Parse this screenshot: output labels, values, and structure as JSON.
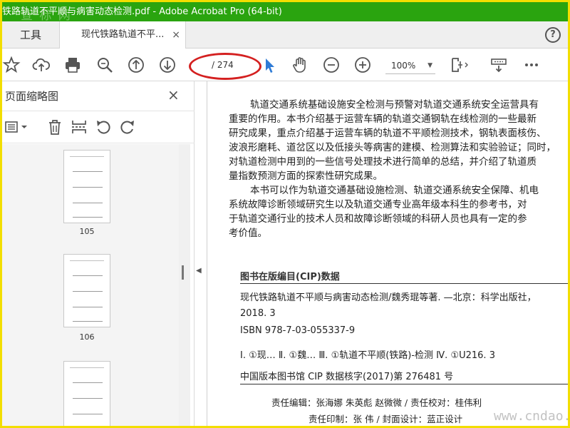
{
  "window": {
    "title": "铁路轨道不平顺与病害动态检测.pdf - Adobe Acrobat Pro (64-bit)",
    "watermark": "查 标 网"
  },
  "tabs": {
    "tools": "工具",
    "document": "现代铁路轨道不平...",
    "close": "×",
    "help": "?"
  },
  "toolbar": {
    "page_current": "",
    "page_total": "/ 274",
    "zoom": "100%"
  },
  "sidebar": {
    "title": "页面缩略图",
    "close": "×",
    "pages": [
      "105",
      "106"
    ]
  },
  "document": {
    "paragraphs": [
      "轨道交通系统基础设施安全检测与预警对轨道交通系统安全运营具有",
      "重要的作用。本书介绍基于运营车辆的轨道交通钢轨在线检测的一些最新",
      "研究成果，重点介绍基于运营车辆的轨道不平顺检测技术，钢轨表面核伤、",
      "波浪形磨耗、道岔区以及低接头等病害的建模、检测算法和实验验证；同时，",
      "对轨道检测中用到的一些信号处理技术进行简单的总结，并介绍了轨道质",
      "量指数预测方面的探索性研究成果。",
      "本书可以作为轨道交通基础设施检测、轨道交通系统安全保障、机电",
      "系统故障诊断领域研究生以及轨道交通专业高年级本科生的参考书，对",
      "于轨道交通行业的技术人员和故障诊断领域的科研人员也具有一定的参",
      "考价值。"
    ],
    "cip_title": "图书在版编目(CIP)数据",
    "cip_line1": "现代铁路轨道不平顺与病害动态检测/魏秀琨等著. —北京：科学出版社，",
    "cip_line2": "2018. 3",
    "isbn": "ISBN 978-7-03-055337-9",
    "classification": "Ⅰ. ①现…    Ⅱ. ①魏…    Ⅲ. ①轨道不平顺(铁路)-检测    Ⅳ. ①U216. 3",
    "cip_number": "中国版本图书馆 CIP 数据核字(2017)第 276481 号",
    "credits1": "责任编辑：张海娜   朱英彪   赵微微 / 责任校对：桂伟利",
    "credits2": "责任印制：张   伟 / 封面设计：蓝正设计",
    "watermark": "www.cndao.com"
  }
}
